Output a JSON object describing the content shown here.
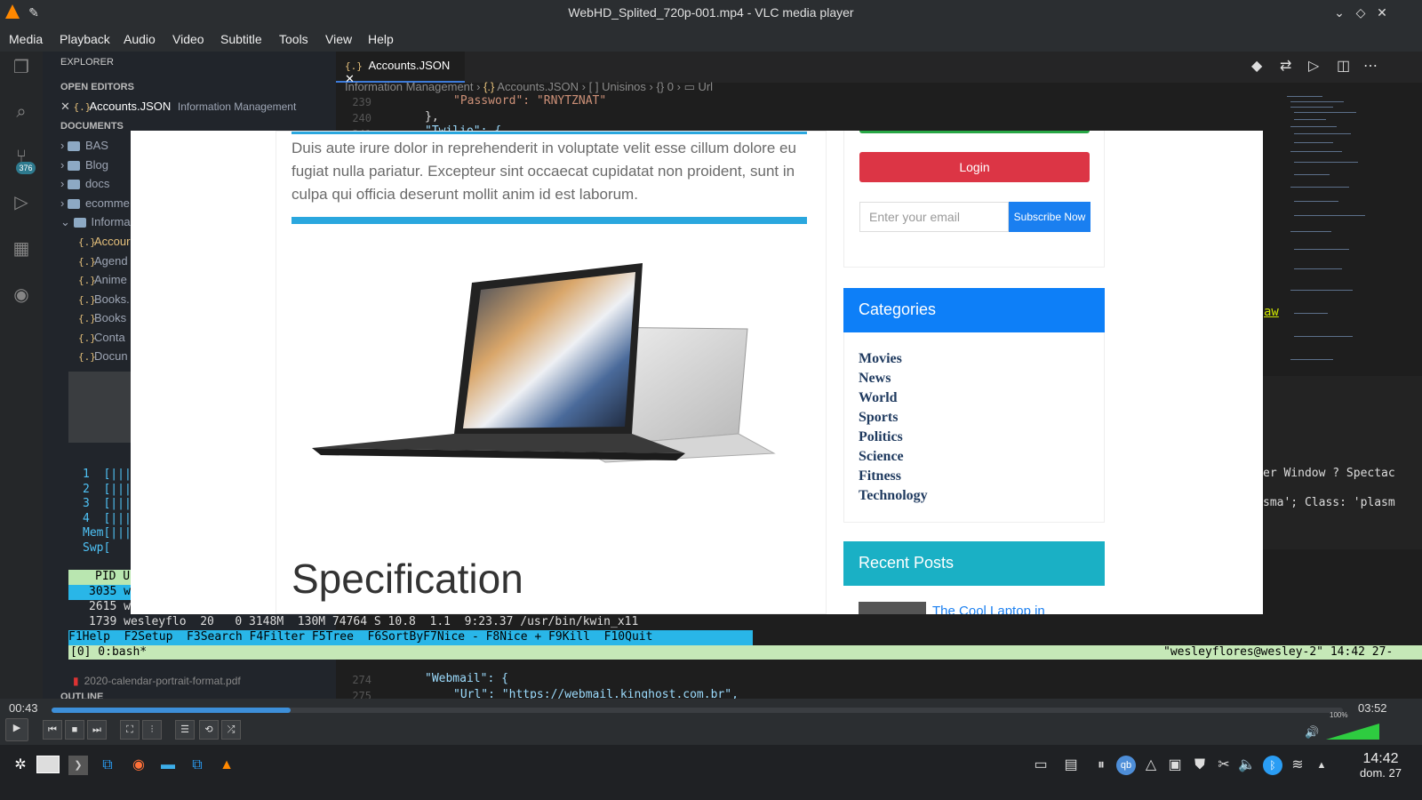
{
  "vlc": {
    "title": "WebHD_Splited_720p-001.mp4 - VLC media player",
    "menu": [
      "Media",
      "Playback",
      "Audio",
      "Video",
      "Subtitle",
      "Tools",
      "View",
      "Help"
    ],
    "time_elapsed": "00:43",
    "time_total": "03:52",
    "progress_fraction": 0.185,
    "volume_label": "100%",
    "volume_fraction": 1.0
  },
  "vscode": {
    "explorer_title": "EXPLORER",
    "open_editors": "OPEN EDITORS",
    "open_file": "Accounts.JSON",
    "open_file_folder": "Information Management",
    "documents": "DOCUMENTS",
    "folders": [
      "BAS",
      "Blog",
      "docs",
      "ecomme",
      "Informa"
    ],
    "files": [
      "Accour",
      "Agend",
      "Anime",
      "Books.",
      "Books",
      "Conta",
      "Docun"
    ],
    "pdf_file": "2020-calendar-portrait-format.pdf",
    "outline": "OUTLINE",
    "tab": "Accounts.JSON",
    "badge": "376",
    "breadcrumb": [
      "Information Management",
      "Accounts.JSON",
      "Unisinos",
      "0",
      "Url"
    ],
    "code_lines": [
      {
        "n": "239",
        "text": "\"Password\": \"RNYTZNAT\""
      },
      {
        "n": "240",
        "text": "},"
      },
      {
        "n": "241",
        "text": "\"Twilio\": {"
      }
    ],
    "code_bottom": [
      {
        "n": "274",
        "text": "\"Webmail\": {"
      },
      {
        "n": "275",
        "text": "\"Url\": \"https://webmail.kinghost.com.br\","
      }
    ],
    "side_text_1": "er Window ? Spectac",
    "side_text_2": "sma'; Class: 'plasm",
    "side_text_3": "aw"
  },
  "htop": {
    "cpu_rows": [
      "1  [|||",
      "2  [|||",
      "3  [|||",
      "4  [|||"
    ],
    "mem": "Mem[|||",
    "swp": "Swp[",
    "header": "PID U",
    "row_sel": "3035 w",
    "row2": "2615 w",
    "row3": "1739 wesleyflo  20   0 3148M  130M 74764 S 10.8  1.1  9:23.37 /usr/bin/kwin_x11",
    "fkeys": "F1Help  F2Setup  F3Search F4Filter F5Tree  F6SortByF7Nice - F8Nice + F9Kill  F10Quit",
    "tmux_left": "[0] 0:bash*",
    "tmux_right": "\"wesleyflores@wesley-2\" 14:42 27-"
  },
  "web": {
    "paragraph": "Duis aute irure dolor in reprehenderit in voluptate velit esse cillum dolore eu fugiat nulla pariatur. Excepteur sint occaecat cupidatat non proident, sunt in culpa qui officia deserunt mollit anim id est laborum.",
    "spec_heading": "Specification",
    "login": "Login",
    "email_placeholder": "Enter your email",
    "subscribe": "Subscribe Now",
    "categories_title": "Categories",
    "categories": [
      "Movies",
      "News",
      "World",
      "Sports",
      "Politics",
      "Science",
      "Fitness",
      "Technology"
    ],
    "recent_title": "Recent Posts",
    "recent_post": "The Cool Laptop in"
  },
  "taskbar": {
    "time": "14:42",
    "date": "dom. 27"
  }
}
